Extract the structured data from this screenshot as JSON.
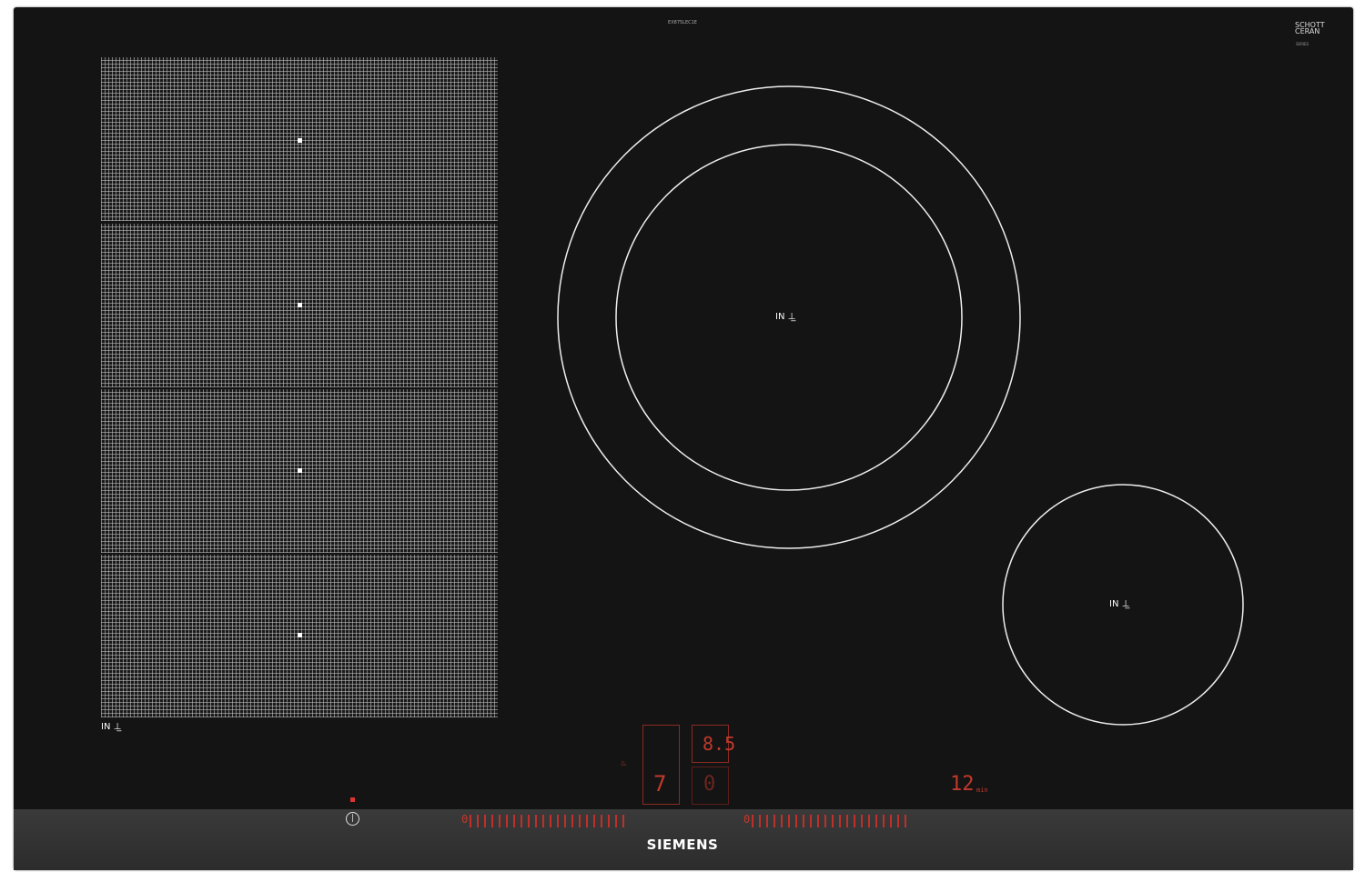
{
  "header": {
    "model_label": "EX875LEC1E",
    "glass_brand": "SCHOTT CERAN",
    "glass_code": "SERIES"
  },
  "zones": {
    "flex_label": "IN",
    "front_label": "IN",
    "small_label": "IN"
  },
  "controls": {
    "power_level_left": "7",
    "power_level_right": "0",
    "frying_level": "8.5",
    "timer_value": "12",
    "timer_unit": "min",
    "slider_left_start": "0",
    "slider_right_start": "0"
  },
  "brand": "SIEMENS",
  "colors": {
    "glass": "#141414",
    "display_red": "#c0392b",
    "strip": "#333333"
  }
}
